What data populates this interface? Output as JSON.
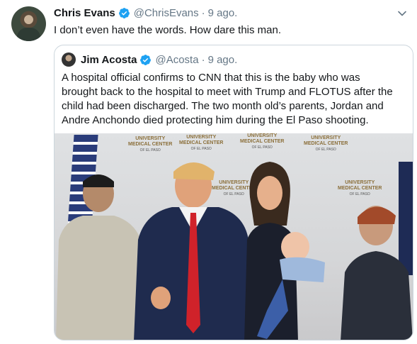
{
  "tweet": {
    "author_name": "Chris Evans",
    "author_handle": "@ChrisEvans",
    "separator": "·",
    "time": "9 ago.",
    "text": "I don’t even have the words. How dare this man."
  },
  "quote": {
    "author_name": "Jim Acosta",
    "author_handle": "@Acosta",
    "separator": "·",
    "time": "9 ago.",
    "lines": [
      "A hospital official confirms to CNN that this is the baby who was",
      "brought back to the hospital to meet with Trump and FLOTUS after the",
      "child had been discharged. The two month old’s parents, Jordan and",
      "Andre Anchondo died protecting him during the El Paso shooting."
    ]
  },
  "backdrop": {
    "line1": "UNIVERSITY",
    "line2": "MEDICAL CENTER",
    "line3": "OF EL PASO"
  },
  "colors": {
    "verified": "#1da1f2",
    "secondary_text": "#657786",
    "border": "#ccd6dd"
  }
}
